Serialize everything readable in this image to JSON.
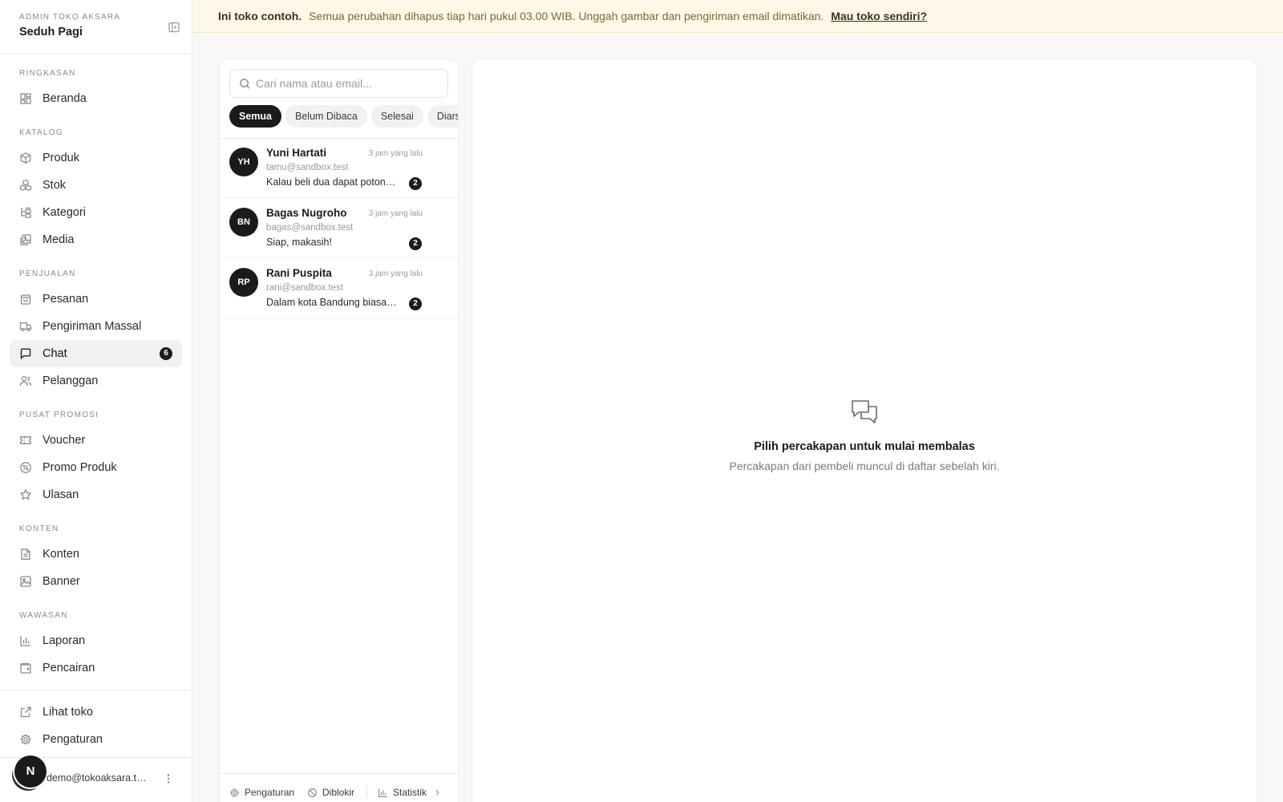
{
  "sidebar": {
    "store_label": "ADMIN TOKO AKSARA",
    "store_name": "Seduh Pagi",
    "sections": {
      "ringkasan": "RINGKASAN",
      "katalog": "KATALOG",
      "penjualan": "PENJUALAN",
      "promosi": "PUSAT PROMOSI",
      "konten": "KONTEN",
      "wawasan": "WAWASAN"
    },
    "items": {
      "beranda": "Beranda",
      "produk": "Produk",
      "stok": "Stok",
      "kategori": "Kategori",
      "media": "Media",
      "pesanan": "Pesanan",
      "pengiriman": "Pengiriman Massal",
      "chat": "Chat",
      "pelanggan": "Pelanggan",
      "voucher": "Voucher",
      "promo": "Promo Produk",
      "ulasan": "Ulasan",
      "konten": "Konten",
      "banner": "Banner",
      "laporan": "Laporan",
      "pencairan": "Pencairan"
    },
    "chat_badge": "6",
    "bottom": {
      "lihat_toko": "Lihat toko",
      "pengaturan": "Pengaturan"
    },
    "user": {
      "avatar_letter": "N",
      "email": "demo@tokoaksara.test"
    }
  },
  "banner": {
    "strong": "Ini toko contoh.",
    "message": "Semua perubahan dihapus tiap hari pukul 03.00 WIB. Unggah gambar dan pengiriman email dimatikan.",
    "link": "Mau toko sendiri?"
  },
  "chat_list": {
    "search_placeholder": "Cari nama atau email...",
    "tabs": [
      "Semua",
      "Belum Dibaca",
      "Selesai",
      "Diarsipkan"
    ],
    "conversations": [
      {
        "initials": "YH",
        "name": "Yuni Hartati",
        "time": "3 jam yang lalu",
        "email": "tamu@sandbox.test",
        "preview": "Kalau beli dua dapat potongan?",
        "unread": "2"
      },
      {
        "initials": "BN",
        "name": "Bagas Nugroho",
        "time": "3 jam yang lalu",
        "email": "bagas@sandbox.test",
        "preview": "Siap, makasih!",
        "unread": "2"
      },
      {
        "initials": "RP",
        "name": "Rani Puspita",
        "time": "3 jam yang lalu",
        "email": "rani@sandbox.test",
        "preview": "Dalam kota Bandung biasanya berapa hari?",
        "unread": "2"
      }
    ],
    "footer": {
      "pengaturan": "Pengaturan",
      "diblokir": "Diblokir",
      "statistik": "Statistik"
    }
  },
  "detail": {
    "empty_title": "Pilih percakapan untuk mulai membalas",
    "empty_subtitle": "Percakapan dari pembeli muncul di daftar sebelah kiri."
  }
}
